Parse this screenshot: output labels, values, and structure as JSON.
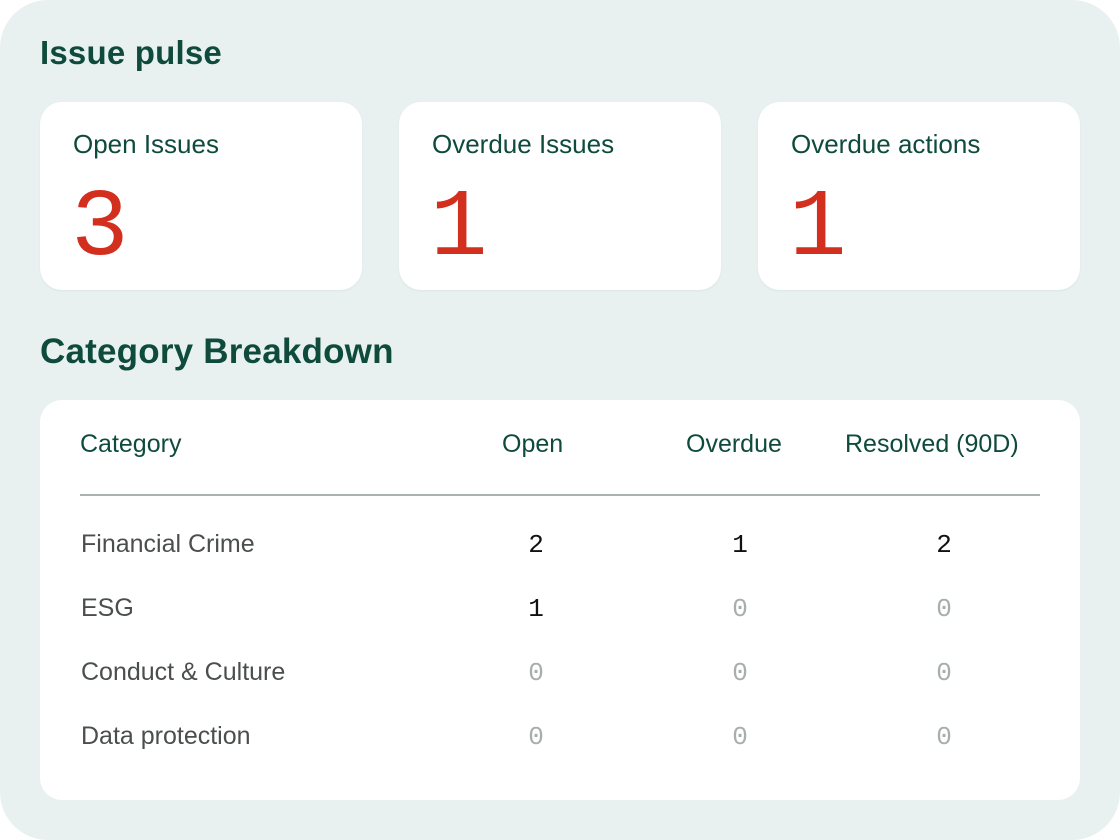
{
  "pulse": {
    "title": "Issue pulse",
    "cards": [
      {
        "label": "Open Issues",
        "value": "3"
      },
      {
        "label": "Overdue Issues",
        "value": "1"
      },
      {
        "label": "Overdue actions",
        "value": "1"
      }
    ]
  },
  "breakdown": {
    "title": "Category Breakdown",
    "columns": [
      "Category",
      "Open",
      "Overdue",
      "Resolved (90D)"
    ],
    "rows": [
      {
        "category": "Financial Crime",
        "open": "2",
        "overdue": "1",
        "resolved": "2"
      },
      {
        "category": "ESG",
        "open": "1",
        "overdue": "0",
        "resolved": "0"
      },
      {
        "category": "Conduct & Culture",
        "open": "0",
        "overdue": "0",
        "resolved": "0"
      },
      {
        "category": "Data protection",
        "open": "0",
        "overdue": "0",
        "resolved": "0"
      }
    ]
  },
  "colors": {
    "background": "#e8f1ef",
    "heading": "#0f4b3c",
    "metric": "#d32f1e",
    "zero": "#a7aeac"
  }
}
